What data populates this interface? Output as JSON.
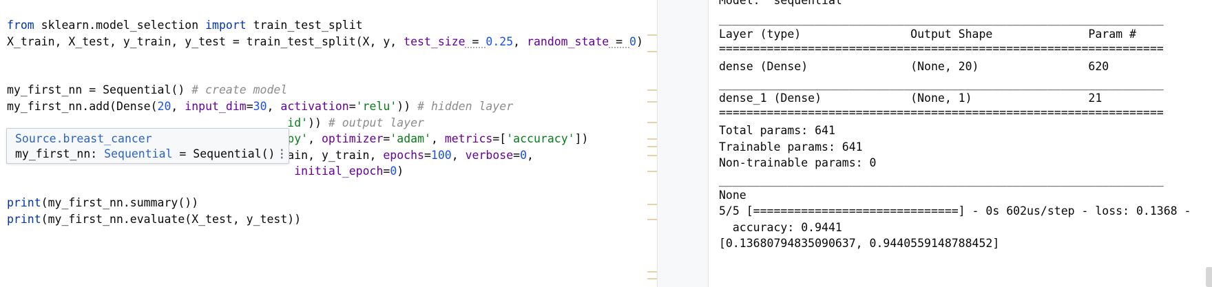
{
  "editor": {
    "line1": {
      "kw_from": "from",
      "module": " sklearn.model_selection ",
      "kw_import": "import",
      "name": " train_test_split"
    },
    "line2": {
      "pre": "X_train, X_test, y_train, y_test = train_test_split(X, y, ",
      "kw1": "test_size",
      "eq1": " = ",
      "v1": "0.25",
      "sep": ", ",
      "kw2": "random_state",
      "eq2": " = ",
      "v2": "0",
      "post": ")"
    },
    "line3": {
      "code": "my_first_nn = Sequential()",
      "comment": " # create model"
    },
    "line4": {
      "pre": "my_first_nn.add(Dense(",
      "n1": "20",
      "sep1": ", ",
      "kw1": "input_dim",
      "eq": "=",
      "n2": "30",
      "sep2": ", ",
      "kw2": "activation",
      "eq2": "=",
      "s": "'relu'",
      "post": "))",
      "comment": " # hidden layer"
    },
    "line5": {
      "visible": "                                         ",
      "s": "id'",
      "post": "))",
      "comment": " # output layer"
    },
    "line6": {
      "visible": "                                        ",
      "s1": "opy'",
      "sep": ", ",
      "kw1": "optimizer",
      "eq1": "=",
      "s2": "'adam'",
      "sep2": ", ",
      "kw2": "metrics",
      "eq2": "=[",
      "s3": "'accuracy'",
      "post": "])"
    },
    "line7": {
      "pre": "my_first_nn_fitted = my_first_nn.fit(X_train, y_train, ",
      "kw1": "epochs",
      "eq1": "=",
      "n1": "100",
      "sep": ", ",
      "kw2": "verbose",
      "eq2": "=",
      "n2": "0",
      "post": ","
    },
    "line8": {
      "indent": "                                          ",
      "kw": "initial_epoch",
      "eq": "=",
      "n": "0",
      "post": ")"
    },
    "line9": {
      "kw": "print",
      "post": "(my_first_nn.summary())"
    },
    "line10": {
      "kw": "print",
      "post": "(my_first_nn.evaluate(X_test, y_test))"
    }
  },
  "tooltip": {
    "module": "Source.breast_cancer",
    "var": "my_first_nn: ",
    "type": "Sequential",
    "rest": " = Sequential()",
    "more": "⋮"
  },
  "console": {
    "lines": [
      "Model: \"sequential\"",
      "_________________________________________________________________",
      "Layer (type)                Output Shape              Param #   ",
      "=================================================================",
      "dense (Dense)               (None, 20)                620       ",
      "_________________________________________________________________",
      "dense_1 (Dense)             (None, 1)                 21        ",
      "=================================================================",
      "Total params: 641",
      "Trainable params: 641",
      "Non-trainable params: 0",
      "_________________________________________________________________",
      "None",
      "5/5 [==============================] - 0s 602us/step - loss: 0.1368 -",
      "  accuracy: 0.9441",
      "[0.13680794835090637, 0.9440559148788452]"
    ]
  }
}
